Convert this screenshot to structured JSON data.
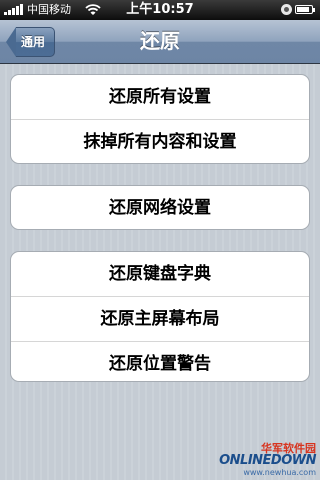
{
  "status_bar": {
    "carrier": "中国移动",
    "time": "上午10:57",
    "battery_level": 0.85
  },
  "nav": {
    "title": "还原",
    "back_label": "通用"
  },
  "groups": [
    {
      "items": [
        "还原所有设置",
        "抹掉所有内容和设置"
      ]
    },
    {
      "items": [
        "还原网络设置"
      ]
    },
    {
      "items": [
        "还原键盘字典",
        "还原主屏幕布局",
        "还原位置警告"
      ]
    }
  ],
  "watermark": {
    "chinese": "华军软件园",
    "brand": "ONLINEDOWN",
    "url": "www.newhua.com"
  }
}
